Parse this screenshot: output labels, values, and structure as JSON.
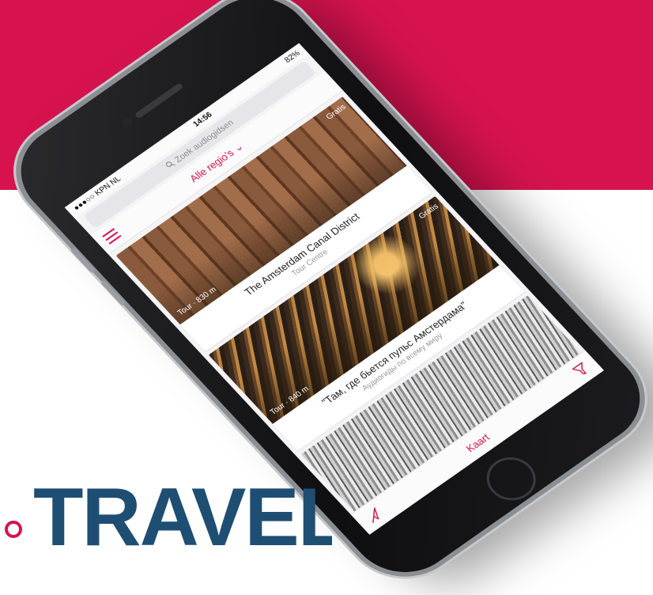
{
  "brand": {
    "text": "TRAVEL",
    "accent": "#d6134f",
    "text_color": "#1f4e73"
  },
  "status_bar": {
    "carrier": "●●●○○ KPN NL",
    "time": "14:56",
    "battery": "82%"
  },
  "search": {
    "placeholder": "Zoek audiogidsen",
    "icon": "search-icon"
  },
  "header": {
    "region_label": "Alle regio's",
    "menu_icon": "hamburger-icon",
    "dropdown_icon": "chevron-down-icon"
  },
  "cards": [
    {
      "title": "The Amsterdam Canal District",
      "subtitle": "Tour Centre",
      "price": "Gratis",
      "length": "Tour · 830 m"
    },
    {
      "title": "\"Там, где бьется пульс Амстердама\"",
      "subtitle": "Аудиогиды по всему миру",
      "price": "Gratis",
      "length": "Tour · 840 m"
    },
    {
      "title": "",
      "subtitle": "",
      "price": "",
      "length": ""
    }
  ],
  "tabbar": {
    "map_label": "Kaart",
    "location_icon": "navigation-arrow-icon",
    "filter_icon": "filter-icon"
  },
  "colors": {
    "band": "#d6134f",
    "accent": "#d6134f"
  }
}
